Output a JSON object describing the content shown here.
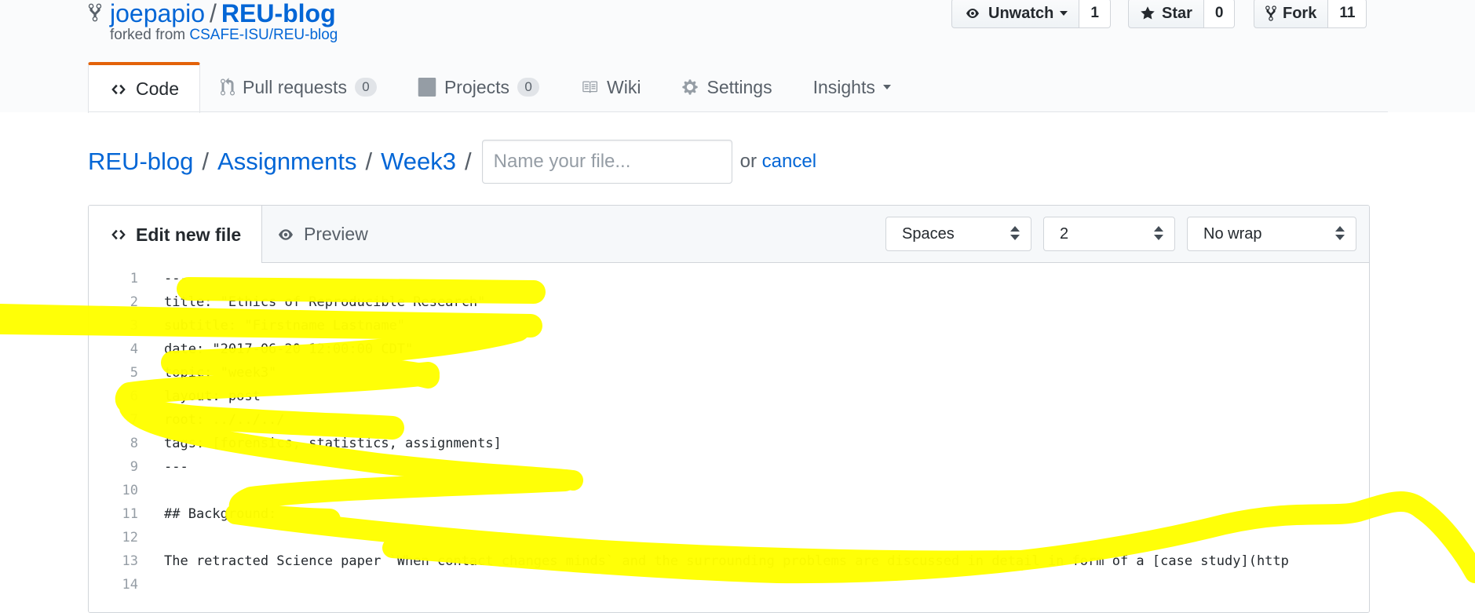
{
  "repo": {
    "owner": "joepapio",
    "separator": "/",
    "name": "REU-blog",
    "forked_prefix": "forked from",
    "forked_source": "CSAFE-ISU/REU-blog"
  },
  "actions": {
    "watch": {
      "label": "Unwatch",
      "count": "1",
      "icon": "eye-icon"
    },
    "star": {
      "label": "Star",
      "count": "0",
      "icon": "star-icon"
    },
    "fork": {
      "label": "Fork",
      "count": "11",
      "icon": "repo-forked-icon"
    }
  },
  "tabs": [
    {
      "label": "Code",
      "icon": "code-icon",
      "selected": true
    },
    {
      "label": "Pull requests",
      "counter": "0",
      "icon": "git-pull-request-icon"
    },
    {
      "label": "Projects",
      "counter": "0",
      "icon": "project-icon"
    },
    {
      "label": "Wiki",
      "icon": "book-icon"
    },
    {
      "label": "Settings",
      "icon": "gear-icon"
    },
    {
      "label": "Insights",
      "icon": "caret-down-icon"
    }
  ],
  "breadcrumb": {
    "items": [
      "REU-blog",
      "Assignments",
      "Week3"
    ],
    "separator": "/",
    "filename_placeholder": "Name your file...",
    "or_text": "or",
    "cancel_label": "cancel"
  },
  "editor": {
    "edit_tab": "Edit new file",
    "preview_tab": "Preview",
    "indent_mode": "Spaces",
    "indent_size": "2",
    "wrap_mode": "No wrap",
    "lines": [
      {
        "n": "1",
        "text": "---"
      },
      {
        "n": "2",
        "text": "title: \"Ethics of Reproducible Research\""
      },
      {
        "n": "3",
        "text": "subtitle: \"Firstname Lastname\""
      },
      {
        "n": "4",
        "text": "date: \"2017-06-20 12:00:00 CDT\""
      },
      {
        "n": "5",
        "text": "topic: \"week3\""
      },
      {
        "n": "6",
        "text": "layout: post"
      },
      {
        "n": "7",
        "text": "root: ../../../"
      },
      {
        "n": "8",
        "text": "tags: [forensics, statistics, assignments]"
      },
      {
        "n": "9",
        "text": "---"
      },
      {
        "n": "10",
        "text": ""
      },
      {
        "n": "11",
        "text": "## Background:"
      },
      {
        "n": "12",
        "text": ""
      },
      {
        "n": "13",
        "text": "The retracted Science paper `When contact changes minds` and the surrounding problems are discussed in detail in form of a [case study](http"
      },
      {
        "n": "14",
        "text": ""
      }
    ]
  },
  "colors": {
    "link": "#0366d6",
    "selected_tab_accent": "#e36209",
    "highlighter": "#ffff00"
  }
}
